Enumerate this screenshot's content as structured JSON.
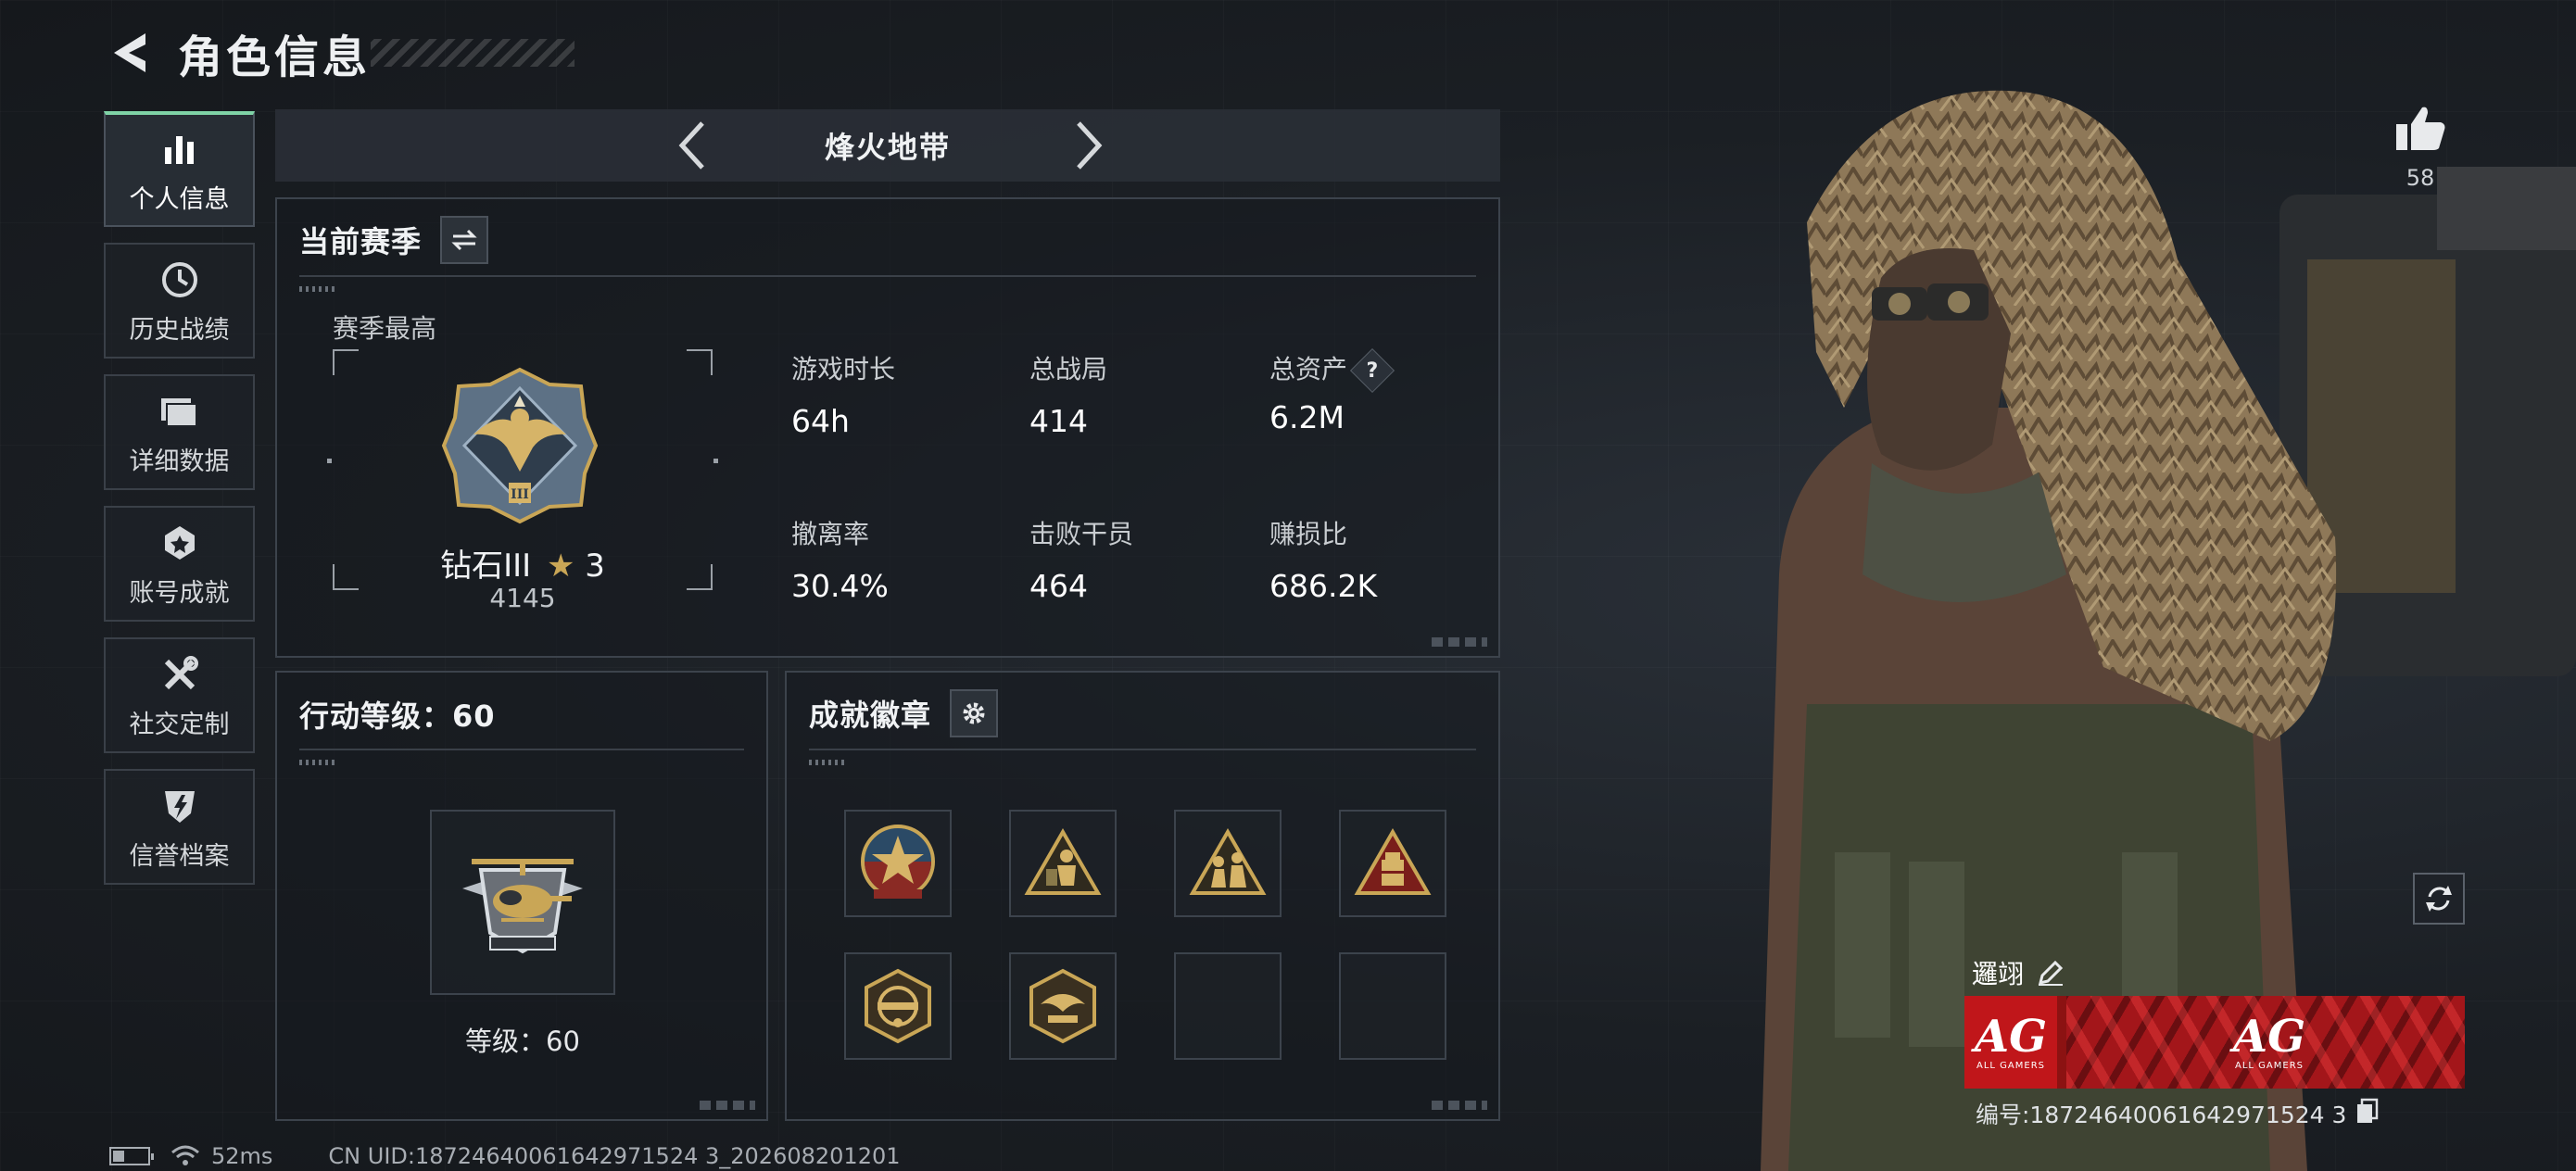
{
  "header": {
    "title": "角色信息"
  },
  "nav": {
    "items": [
      {
        "label": "个人信息",
        "active": true
      },
      {
        "label": "历史战绩"
      },
      {
        "label": "详细数据"
      },
      {
        "label": "账号成就"
      },
      {
        "label": "社交定制"
      },
      {
        "label": "信誉档案"
      }
    ]
  },
  "mode": {
    "title": "烽火地带"
  },
  "season": {
    "title": "当前赛季",
    "best_label": "赛季最高",
    "rank_name": "钻石III",
    "rank_stars": "3",
    "rank_score": "4145",
    "stats": [
      {
        "label": "游戏时长",
        "value": "64h"
      },
      {
        "label": "总战局",
        "value": "414"
      },
      {
        "label": "总资产",
        "value": "6.2M",
        "help": "?"
      },
      {
        "label": "撤离率",
        "value": "30.4%"
      },
      {
        "label": "击败干员",
        "value": "464"
      },
      {
        "label": "赚损比",
        "value": "686.2K"
      }
    ]
  },
  "level": {
    "title": "行动等级：60",
    "caption": "等级：60"
  },
  "badges": {
    "title": "成就徽章",
    "slots": [
      {
        "icon": "star-medal-badge"
      },
      {
        "icon": "soldier-triangle-badge"
      },
      {
        "icon": "squad-triangle-badge"
      },
      {
        "icon": "crate-triangle-badge"
      },
      {
        "icon": "hexagon-emblem-badge"
      },
      {
        "icon": "crest-emblem-badge"
      },
      {
        "icon": ""
      },
      {
        "icon": ""
      }
    ]
  },
  "footer": {
    "ping": "52ms",
    "uid": "CN UID:18724640061642971524 3_202608201201"
  },
  "character": {
    "likes": "58",
    "player_name": "邏翊",
    "banner_logo": "AG",
    "banner_sub": "ALL GAMERS",
    "serial": "编号:18724640061642971524 3"
  },
  "colors": {
    "accent": "#7fd3a6",
    "panel_border": "#3c434c",
    "banner_red": "#c0161a",
    "gold": "#c9a656"
  }
}
